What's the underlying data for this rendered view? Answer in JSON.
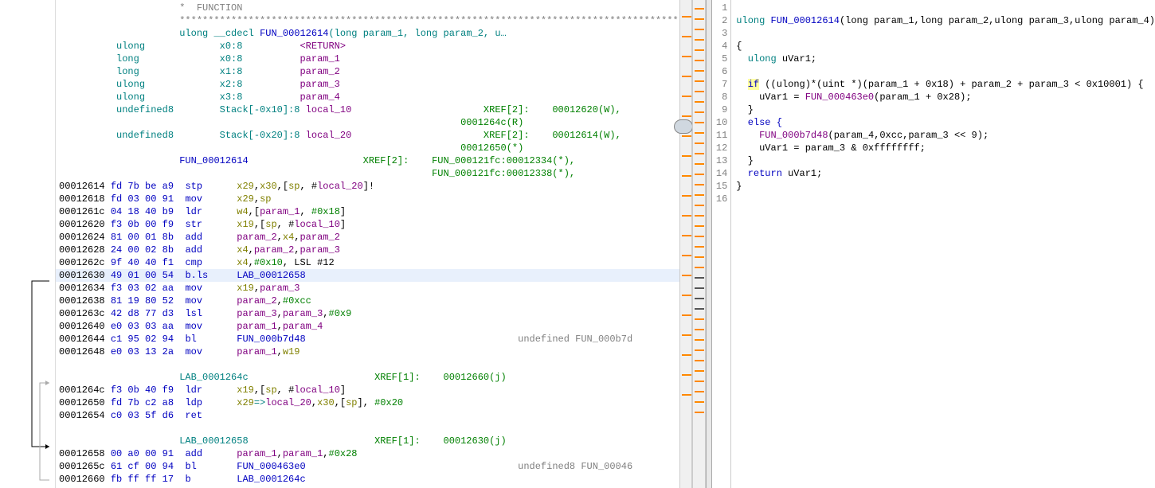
{
  "header": {
    "func_comment": "*  FUNCTION                                                                                 *",
    "stars": "*********************************************************************************************",
    "signature_pre": "ulong __cdecl ",
    "signature_name": "FUN_00012614",
    "signature_post": "(long param_1, long param_2, u…"
  },
  "decls": [
    {
      "type": "ulong",
      "storage": "x0:8",
      "name": "<RETURN>"
    },
    {
      "type": "long",
      "storage": "x0:8",
      "name": "param_1"
    },
    {
      "type": "long",
      "storage": "x1:8",
      "name": "param_2"
    },
    {
      "type": "ulong",
      "storage": "x2:8",
      "name": "param_3"
    },
    {
      "type": "ulong",
      "storage": "x3:8",
      "name": "param_4"
    }
  ],
  "stackvars": [
    {
      "type": "undefined8",
      "storage": "Stack[-0x10]:8 ",
      "name": "local_10",
      "xref_lbl": "XREF[2]:",
      "xrefs": [
        "00012620(W)",
        "0001264c(R)"
      ]
    },
    {
      "type": "undefined8",
      "storage": "Stack[-0x20]:8 ",
      "name": "local_20",
      "xref_lbl": "XREF[2]:",
      "xrefs": [
        "00012614(W)",
        "00012650(*)"
      ]
    }
  ],
  "funclabel": {
    "name": "FUN_00012614",
    "xref_lbl": "XREF[2]:",
    "xrefs": [
      "FUN_000121fc:00012334(*)",
      "FUN_000121fc:00012338(*)"
    ]
  },
  "instructions": [
    {
      "addr": "00012614",
      "bytes": "fd 7b be a9",
      "mnem": "stp",
      "ops": [
        {
          "t": "reg",
          "v": "x29"
        },
        {
          "t": "p",
          "v": ","
        },
        {
          "t": "reg",
          "v": "x30"
        },
        {
          "t": "p",
          "v": ",["
        },
        {
          "t": "reg",
          "v": "sp"
        },
        {
          "t": "p",
          "v": ", #"
        },
        {
          "t": "param",
          "v": "local_20"
        },
        {
          "t": "p",
          "v": "]!"
        }
      ]
    },
    {
      "addr": "00012618",
      "bytes": "fd 03 00 91",
      "mnem": "mov",
      "ops": [
        {
          "t": "reg",
          "v": "x29"
        },
        {
          "t": "p",
          "v": ","
        },
        {
          "t": "reg",
          "v": "sp"
        }
      ]
    },
    {
      "addr": "0001261c",
      "bytes": "04 18 40 b9",
      "mnem": "ldr",
      "ops": [
        {
          "t": "reg",
          "v": "w4"
        },
        {
          "t": "p",
          "v": ",["
        },
        {
          "t": "param",
          "v": "param_1"
        },
        {
          "t": "p",
          "v": ", "
        },
        {
          "t": "num",
          "v": "#0x18"
        },
        {
          "t": "p",
          "v": "]"
        }
      ]
    },
    {
      "addr": "00012620",
      "bytes": "f3 0b 00 f9",
      "mnem": "str",
      "ops": [
        {
          "t": "reg",
          "v": "x19"
        },
        {
          "t": "p",
          "v": ",["
        },
        {
          "t": "reg",
          "v": "sp"
        },
        {
          "t": "p",
          "v": ", #"
        },
        {
          "t": "param",
          "v": "local_10"
        },
        {
          "t": "p",
          "v": "]"
        }
      ]
    },
    {
      "addr": "00012624",
      "bytes": "81 00 01 8b",
      "mnem": "add",
      "ops": [
        {
          "t": "param",
          "v": "param_2"
        },
        {
          "t": "p",
          "v": ","
        },
        {
          "t": "reg",
          "v": "x4"
        },
        {
          "t": "p",
          "v": ","
        },
        {
          "t": "param",
          "v": "param_2"
        }
      ]
    },
    {
      "addr": "00012628",
      "bytes": "24 00 02 8b",
      "mnem": "add",
      "ops": [
        {
          "t": "reg",
          "v": "x4"
        },
        {
          "t": "p",
          "v": ","
        },
        {
          "t": "param",
          "v": "param_2"
        },
        {
          "t": "p",
          "v": ","
        },
        {
          "t": "param",
          "v": "param_3"
        }
      ]
    },
    {
      "addr": "0001262c",
      "bytes": "9f 40 40 f1",
      "mnem": "cmp",
      "ops": [
        {
          "t": "reg",
          "v": "x4"
        },
        {
          "t": "p",
          "v": ","
        },
        {
          "t": "num",
          "v": "#0x10"
        },
        {
          "t": "p",
          "v": ", LSL #12"
        }
      ]
    },
    {
      "addr": "00012630",
      "bytes": "49 01 00 54",
      "mnem": "b.ls",
      "ops": [
        {
          "t": "label",
          "v": "LAB_00012658"
        }
      ],
      "hl": true
    },
    {
      "addr": "00012634",
      "bytes": "f3 03 02 aa",
      "mnem": "mov",
      "ops": [
        {
          "t": "reg",
          "v": "x19"
        },
        {
          "t": "p",
          "v": ","
        },
        {
          "t": "param",
          "v": "param_3"
        }
      ]
    },
    {
      "addr": "00012638",
      "bytes": "81 19 80 52",
      "mnem": "mov",
      "ops": [
        {
          "t": "param",
          "v": "param_2"
        },
        {
          "t": "p",
          "v": ","
        },
        {
          "t": "num",
          "v": "#0xcc"
        }
      ]
    },
    {
      "addr": "0001263c",
      "bytes": "42 d8 77 d3",
      "mnem": "lsl",
      "ops": [
        {
          "t": "param",
          "v": "param_3"
        },
        {
          "t": "p",
          "v": ","
        },
        {
          "t": "param",
          "v": "param_3"
        },
        {
          "t": "p",
          "v": ","
        },
        {
          "t": "num",
          "v": "#0x9"
        }
      ]
    },
    {
      "addr": "00012640",
      "bytes": "e0 03 03 aa",
      "mnem": "mov",
      "ops": [
        {
          "t": "param",
          "v": "param_1"
        },
        {
          "t": "p",
          "v": ","
        },
        {
          "t": "param",
          "v": "param_4"
        }
      ]
    },
    {
      "addr": "00012644",
      "bytes": "c1 95 02 94",
      "mnem": "bl",
      "ops": [
        {
          "t": "func",
          "v": "FUN_000b7d48"
        }
      ],
      "cmt": "undefined FUN_000b7d"
    },
    {
      "addr": "00012648",
      "bytes": "e0 03 13 2a",
      "mnem": "mov",
      "ops": [
        {
          "t": "param",
          "v": "param_1"
        },
        {
          "t": "p",
          "v": ","
        },
        {
          "t": "reg",
          "v": "w19"
        }
      ]
    }
  ],
  "lab1": {
    "name": "LAB_0001264c",
    "xref_lbl": "XREF[1]:",
    "xrefs": [
      "00012660(j)"
    ]
  },
  "block2": [
    {
      "addr": "0001264c",
      "bytes": "f3 0b 40 f9",
      "mnem": "ldr",
      "ops": [
        {
          "t": "reg",
          "v": "x19"
        },
        {
          "t": "p",
          "v": ",["
        },
        {
          "t": "reg",
          "v": "sp"
        },
        {
          "t": "p",
          "v": ", #"
        },
        {
          "t": "param",
          "v": "local_10"
        },
        {
          "t": "p",
          "v": "]"
        }
      ]
    },
    {
      "addr": "00012650",
      "bytes": "fd 7b c2 a8",
      "mnem": "ldp",
      "ops": [
        {
          "t": "reg",
          "v": "x29"
        },
        {
          "t": "teal",
          "v": "=>"
        },
        {
          "t": "param",
          "v": "local_20"
        },
        {
          "t": "p",
          "v": ","
        },
        {
          "t": "reg",
          "v": "x30"
        },
        {
          "t": "p",
          "v": ",["
        },
        {
          "t": "reg",
          "v": "sp"
        },
        {
          "t": "p",
          "v": "], "
        },
        {
          "t": "num",
          "v": "#0x20"
        }
      ]
    },
    {
      "addr": "00012654",
      "bytes": "c0 03 5f d6",
      "mnem": "ret",
      "ops": []
    }
  ],
  "lab2": {
    "name": "LAB_00012658",
    "xref_lbl": "XREF[1]:",
    "xrefs": [
      "00012630(j)"
    ]
  },
  "block3": [
    {
      "addr": "00012658",
      "bytes": "00 a0 00 91",
      "mnem": "add",
      "ops": [
        {
          "t": "param",
          "v": "param_1"
        },
        {
          "t": "p",
          "v": ","
        },
        {
          "t": "param",
          "v": "param_1"
        },
        {
          "t": "p",
          "v": ","
        },
        {
          "t": "num",
          "v": "#0x28"
        }
      ]
    },
    {
      "addr": "0001265c",
      "bytes": "61 cf 00 94",
      "mnem": "bl",
      "ops": [
        {
          "t": "func",
          "v": "FUN_000463e0"
        }
      ],
      "cmt": "undefined8 FUN_00046"
    },
    {
      "addr": "00012660",
      "bytes": "fb ff ff 17",
      "mnem": "b",
      "ops": [
        {
          "t": "label",
          "v": "LAB_0001264c"
        }
      ]
    }
  ],
  "decomp_lines": 16,
  "decomp": {
    "l2_pre": "ulong ",
    "l2_name": "FUN_00012614",
    "l2_post": "(long param_1,long param_2,ulong param_3,ulong param_4)",
    "l4": "{",
    "l5_pre": "  ulong ",
    "l5_var": "uVar1",
    "l7_if": "if",
    "l7_body": " ((ulong)*(uint *)(param_1 + 0x18) + param_2 + param_3 < 0x10001) {",
    "l8_pre": "    uVar1 = ",
    "l8_fn": "FUN_000463e0",
    "l8_post": "(param_1 + 0x28);",
    "l9": "  }",
    "l10_else": "  else {",
    "l11_pre": "    ",
    "l11_fn": "FUN_000b7d48",
    "l11_post": "(param_4,0xcc,param_3 << 9);",
    "l12": "    uVar1 = param_3 & 0xffffffff;",
    "l13": "  }",
    "l14_ret": "  return",
    "l14_post": " uVar1;",
    "l15": "}"
  }
}
